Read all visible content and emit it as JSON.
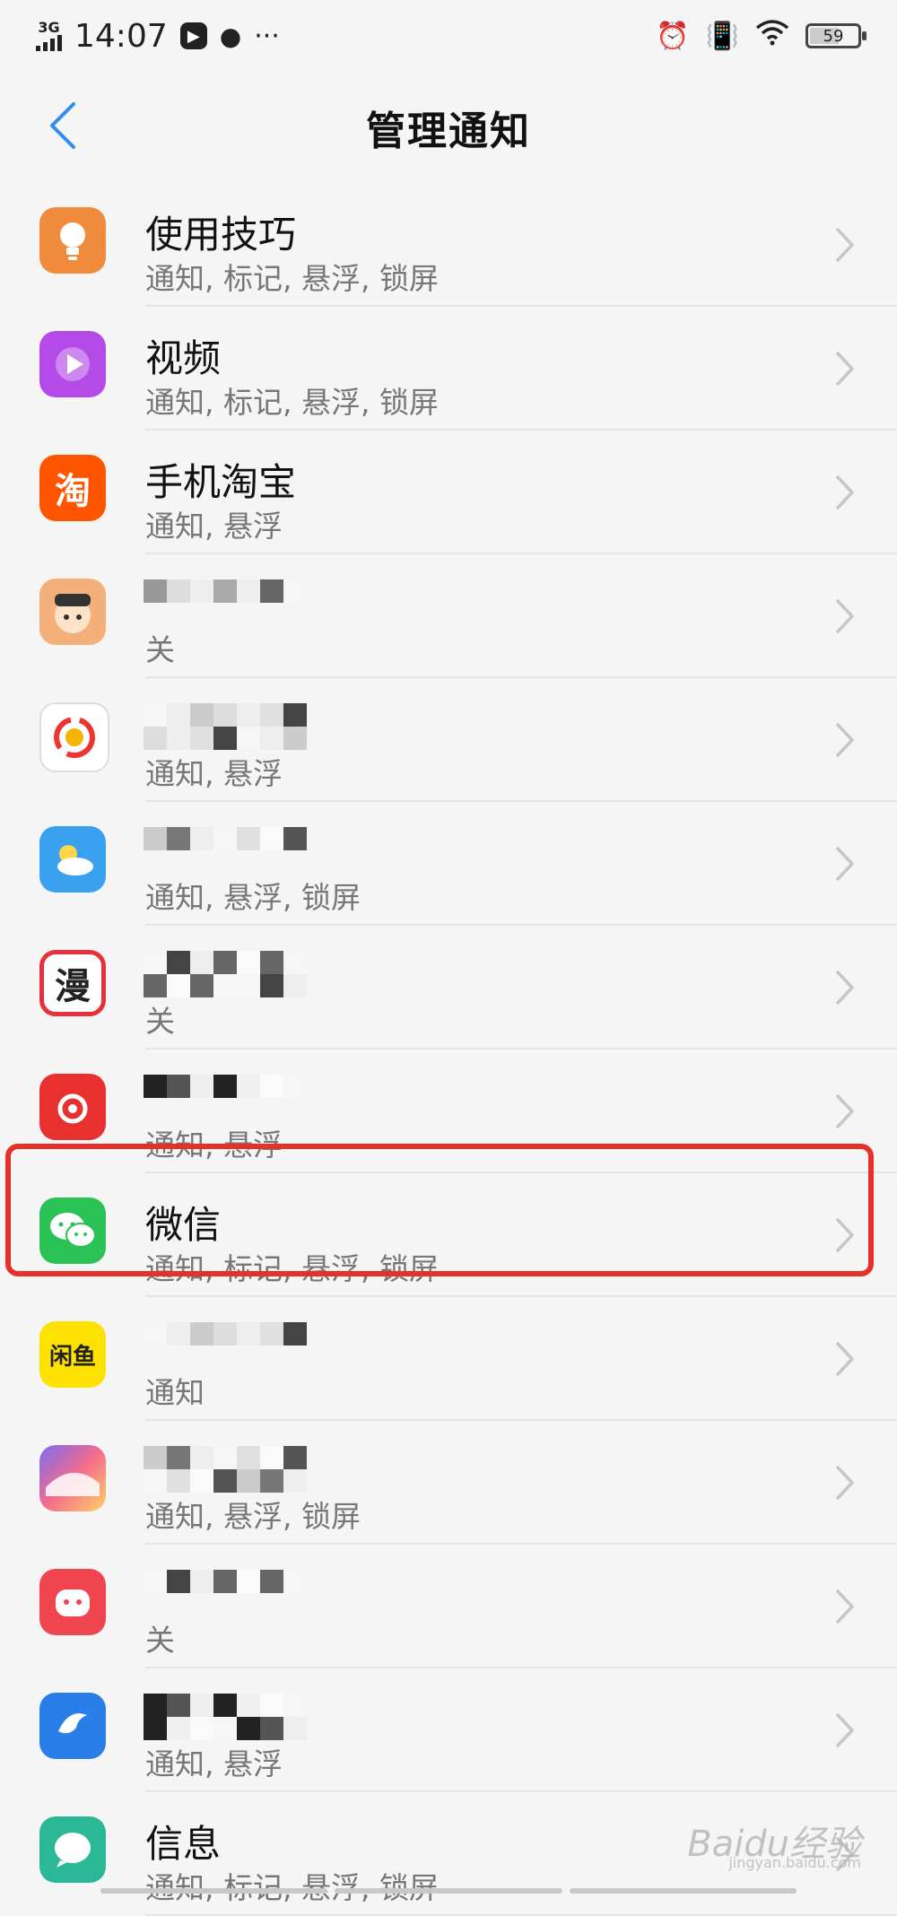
{
  "status": {
    "network": "3G",
    "time": "14:07",
    "more": "···",
    "battery": "59"
  },
  "header": {
    "title": "管理通知"
  },
  "apps": [
    {
      "name": "使用技巧",
      "sub": "通知, 标记, 悬浮, 锁屏",
      "icon": "tips-icon",
      "color": "#f08a3c"
    },
    {
      "name": "视频",
      "sub": "通知, 标记, 悬浮, 锁屏",
      "icon": "video-icon",
      "color": "#b44ae8"
    },
    {
      "name": "手机淘宝",
      "sub": "通知, 悬浮",
      "icon": "taobao-icon",
      "color": "#ff5500",
      "glyph": "淘"
    },
    {
      "name": "",
      "sub": "关",
      "icon": "cartoon-app-icon",
      "color": "#f4b07a"
    },
    {
      "name": "",
      "sub": "通知, 悬浮",
      "icon": "news-app-icon",
      "color": "#ffffff"
    },
    {
      "name": "",
      "sub": "通知, 悬浮, 锁屏",
      "icon": "weather-icon",
      "color": "#3aa0f0"
    },
    {
      "name": "",
      "sub": "关",
      "icon": "comic-app-icon",
      "color": "#e8303a",
      "glyph": "漫"
    },
    {
      "name": "",
      "sub": "通知, 悬浮",
      "icon": "music-app-icon",
      "color": "#e8302e"
    },
    {
      "name": "微信",
      "sub": "通知, 标记, 悬浮, 锁屏",
      "icon": "wechat-icon",
      "color": "#2bc255"
    },
    {
      "name": "",
      "sub": "通知",
      "icon": "xianyu-icon",
      "color": "#ffe100",
      "glyph": "闲鱼"
    },
    {
      "name": "",
      "sub": "通知, 悬浮, 锁屏",
      "icon": "theme-app-icon",
      "color": "#4a7ef0"
    },
    {
      "name": "",
      "sub": "关",
      "icon": "mascot-app-icon",
      "color": "#f0444e"
    },
    {
      "name": "",
      "sub": "通知, 悬浮",
      "icon": "dolphin-app-icon",
      "color": "#2a7ee8"
    },
    {
      "name": "信息",
      "sub": "通知, 标记, 悬浮, 锁屏",
      "icon": "message-icon",
      "color": "#2ab896"
    }
  ],
  "watermark": {
    "brand": "Baidu经验",
    "url": "jingyan.baidu.com"
  },
  "highlight_color": "#e8302a"
}
